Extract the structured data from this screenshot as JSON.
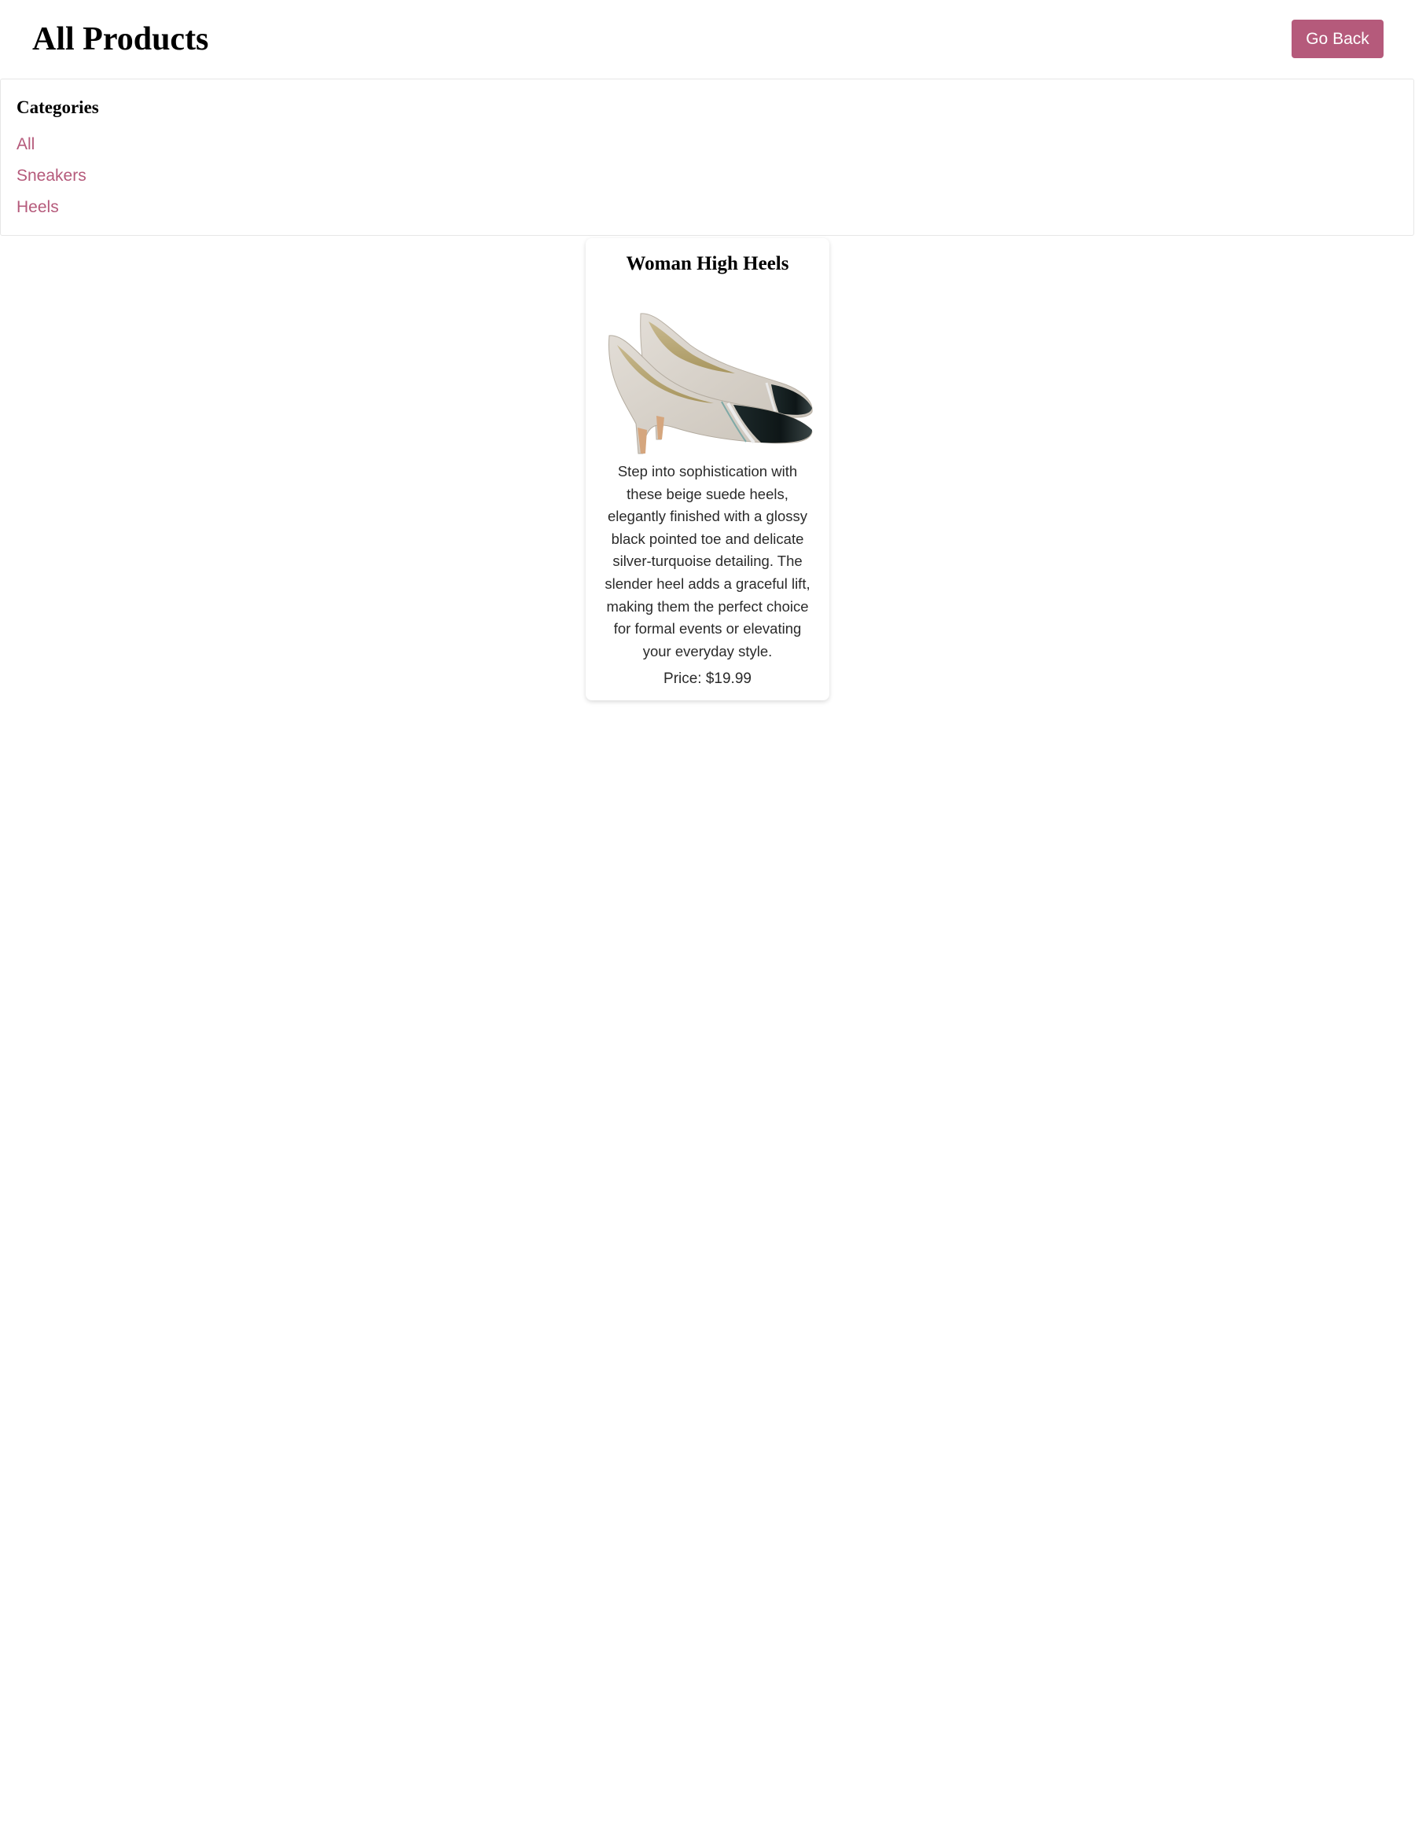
{
  "header": {
    "title": "All Products",
    "go_back_label": "Go Back"
  },
  "categories": {
    "heading": "Categories",
    "items": [
      {
        "label": "All"
      },
      {
        "label": "Sneakers"
      },
      {
        "label": "Heels"
      }
    ]
  },
  "products": [
    {
      "name": "Woman High Heels",
      "image_icon": "high-heels-image",
      "description": "Step into sophistication with these beige suede heels, elegantly finished with a glossy black pointed toe and delicate silver-turquoise detailing. The slender heel adds a graceful lift, making them the perfect choice for formal events or elevating your everyday style.",
      "price": "Price: $19.99"
    }
  ],
  "colors": {
    "accent": "#b55a7b",
    "text": "#222222",
    "border": "#e6e6e6"
  }
}
